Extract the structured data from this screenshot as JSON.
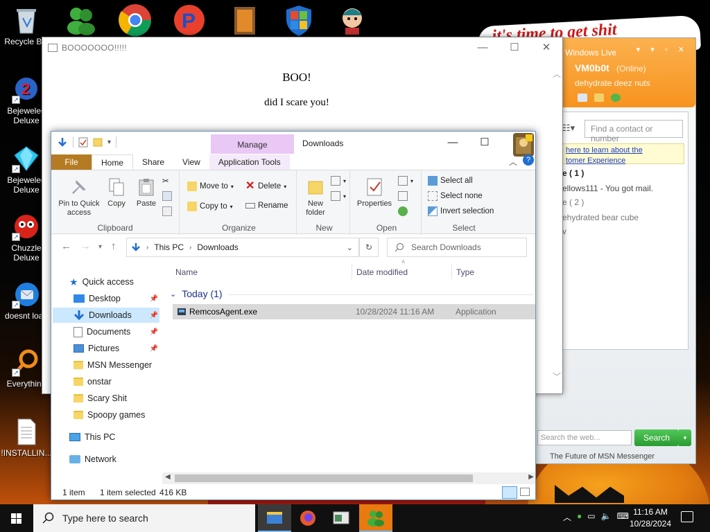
{
  "desktop": {
    "wallpaper_text": "it's time to get shit",
    "icons": [
      {
        "label": "Recycle Bin",
        "icon": "recycle-bin-icon"
      },
      {
        "label": "Bejeweled Deluxe",
        "icon": "bejeweled-2-icon"
      },
      {
        "label": "Bejeweled Deluxe",
        "icon": "bejeweled-gem-icon"
      },
      {
        "label": "Chuzzle Deluxe",
        "icon": "chuzzle-icon"
      },
      {
        "label": "doesnt load",
        "icon": "thunderbird-icon"
      },
      {
        "label": "Everything",
        "icon": "everything-search-icon"
      },
      {
        "label": "!INSTALLIN...",
        "icon": "text-document-icon"
      }
    ]
  },
  "boo_window": {
    "title": "BOOOOOOO!!!!!",
    "line1": "BOO!",
    "line2": "did I scare you!"
  },
  "msn": {
    "brand": "Windows Live",
    "username": "VM0b0t",
    "status": "(Online)",
    "personal_message": "dehydrate deez nuts",
    "find_placeholder": "Find a contact or number",
    "notice_line1": "here to learn about the",
    "notice_line2": "tomer Experience",
    "groups": [
      {
        "label": "e ( 1 )"
      },
      {
        "label": "ellows111 - You got mail."
      },
      {
        "label": "e ( 2 )"
      },
      {
        "label": "ehydrated bear cube"
      },
      {
        "label": "v"
      }
    ],
    "web_search_placeholder": "Search the web...",
    "search_button": "Search",
    "footer": "The Future of MSN Messenger"
  },
  "explorer": {
    "title": "Downloads",
    "manage_tab": "Manage",
    "tabs": {
      "file": "File",
      "home": "Home",
      "share": "Share",
      "view": "View",
      "app_tools": "Application Tools"
    },
    "ribbon": {
      "clipboard": {
        "label": "Clipboard",
        "pin": "Pin to Quick access",
        "copy": "Copy",
        "paste": "Paste"
      },
      "organize": {
        "label": "Organize",
        "move_to": "Move to",
        "copy_to": "Copy to",
        "delete": "Delete",
        "rename": "Rename"
      },
      "new": {
        "label": "New",
        "new_folder": "New folder"
      },
      "open": {
        "label": "Open",
        "properties": "Properties"
      },
      "select": {
        "label": "Select",
        "select_all": "Select all",
        "select_none": "Select none",
        "invert": "Invert selection"
      }
    },
    "address": {
      "segments": [
        "This PC",
        "Downloads"
      ],
      "search_placeholder": "Search Downloads"
    },
    "nav": {
      "quick_access": "Quick access",
      "items": [
        {
          "label": "Desktop",
          "pinned": true
        },
        {
          "label": "Downloads",
          "pinned": true,
          "selected": true
        },
        {
          "label": "Documents",
          "pinned": true
        },
        {
          "label": "Pictures",
          "pinned": true
        },
        {
          "label": "MSN Messenger"
        },
        {
          "label": "onstar"
        },
        {
          "label": "Scary Shit"
        },
        {
          "label": "Spoopy games"
        }
      ],
      "this_pc": "This PC",
      "network": "Network"
    },
    "columns": {
      "name": "Name",
      "date": "Date modified",
      "type": "Type"
    },
    "group": "Today (1)",
    "files": [
      {
        "name": "RemcosAgent.exe",
        "date": "10/28/2024 11:16 AM",
        "type": "Application"
      }
    ],
    "status": {
      "count": "1 item",
      "selected": "1 item selected",
      "size": "416 KB"
    }
  },
  "taskbar": {
    "search_placeholder": "Type here to search",
    "time": "11:16 AM",
    "date": "10/28/2024"
  }
}
